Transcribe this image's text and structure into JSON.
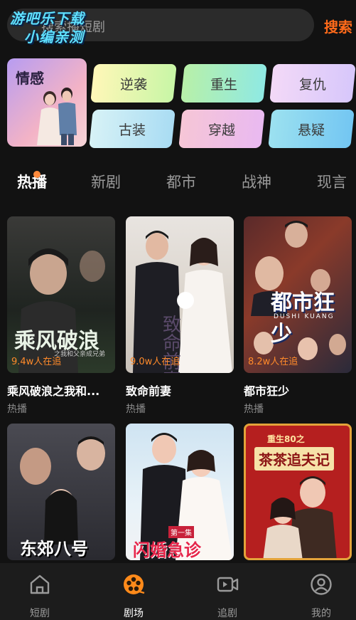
{
  "watermark": {
    "line1": "游吧乐下载",
    "line2": "小编亲测"
  },
  "search": {
    "placeholder": "搜索播短剧",
    "button": "搜索"
  },
  "categories": {
    "feature": "情感",
    "chips": [
      "逆袭",
      "重生",
      "复仇",
      "古装",
      "穿越",
      "悬疑"
    ]
  },
  "tabs": [
    "热播",
    "新剧",
    "都市",
    "战神",
    "现言"
  ],
  "cards": [
    {
      "title": "乘风破浪之我和...",
      "tag": "热播",
      "watchers": "9.4w人在追",
      "poster_text": "乘风破浪",
      "poster_sub": "之我和父亲成兄弟"
    },
    {
      "title": "致命前妻",
      "tag": "热播",
      "watchers": "9.0w人在追",
      "poster_text": "致命前妻",
      "poster_sub": ""
    },
    {
      "title": "都市狂少",
      "tag": "热播",
      "watchers": "8.2w人在追",
      "poster_text": "都市狂少",
      "poster_sub": "DUSHI KUANG"
    },
    {
      "title": "",
      "tag": "",
      "watchers": "",
      "poster_text": "东郊八号",
      "poster_sub": ""
    },
    {
      "title": "",
      "tag": "",
      "watchers": "",
      "poster_text": "闪婚急诊",
      "poster_sub": "第一集"
    },
    {
      "title": "",
      "tag": "",
      "watchers": "",
      "poster_text": "茶茶追夫记",
      "poster_sub": "重生80之"
    }
  ],
  "nav": [
    {
      "label": "短剧",
      "icon": "home-icon",
      "active": false
    },
    {
      "label": "剧场",
      "icon": "film-reel-icon",
      "active": true
    },
    {
      "label": "追剧",
      "icon": "video-camera-icon",
      "active": false
    },
    {
      "label": "我的",
      "icon": "user-icon",
      "active": false
    }
  ],
  "colors": {
    "accent": "#ff6a1a",
    "background": "#121212",
    "watchers": "#ff8a2a"
  }
}
